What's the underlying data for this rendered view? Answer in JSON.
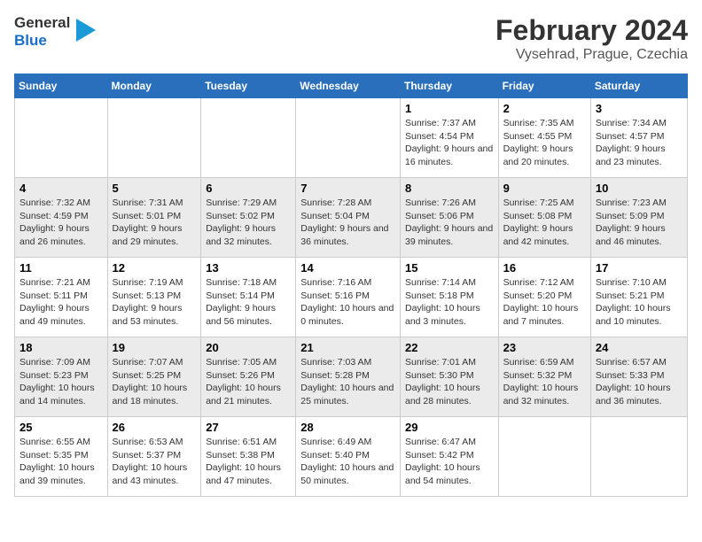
{
  "header": {
    "logo_line1": "General",
    "logo_line2": "Blue",
    "title": "February 2024",
    "subtitle": "Vysehrad, Prague, Czechia"
  },
  "weekdays": [
    "Sunday",
    "Monday",
    "Tuesday",
    "Wednesday",
    "Thursday",
    "Friday",
    "Saturday"
  ],
  "weeks": [
    [
      {
        "day": "",
        "empty": true
      },
      {
        "day": "",
        "empty": true
      },
      {
        "day": "",
        "empty": true
      },
      {
        "day": "",
        "empty": true
      },
      {
        "day": "1",
        "sunrise": "7:37 AM",
        "sunset": "4:54 PM",
        "daylight": "9 hours and 16 minutes."
      },
      {
        "day": "2",
        "sunrise": "7:35 AM",
        "sunset": "4:55 PM",
        "daylight": "9 hours and 20 minutes."
      },
      {
        "day": "3",
        "sunrise": "7:34 AM",
        "sunset": "4:57 PM",
        "daylight": "9 hours and 23 minutes."
      }
    ],
    [
      {
        "day": "4",
        "sunrise": "7:32 AM",
        "sunset": "4:59 PM",
        "daylight": "9 hours and 26 minutes."
      },
      {
        "day": "5",
        "sunrise": "7:31 AM",
        "sunset": "5:01 PM",
        "daylight": "9 hours and 29 minutes."
      },
      {
        "day": "6",
        "sunrise": "7:29 AM",
        "sunset": "5:02 PM",
        "daylight": "9 hours and 32 minutes."
      },
      {
        "day": "7",
        "sunrise": "7:28 AM",
        "sunset": "5:04 PM",
        "daylight": "9 hours and 36 minutes."
      },
      {
        "day": "8",
        "sunrise": "7:26 AM",
        "sunset": "5:06 PM",
        "daylight": "9 hours and 39 minutes."
      },
      {
        "day": "9",
        "sunrise": "7:25 AM",
        "sunset": "5:08 PM",
        "daylight": "9 hours and 42 minutes."
      },
      {
        "day": "10",
        "sunrise": "7:23 AM",
        "sunset": "5:09 PM",
        "daylight": "9 hours and 46 minutes."
      }
    ],
    [
      {
        "day": "11",
        "sunrise": "7:21 AM",
        "sunset": "5:11 PM",
        "daylight": "9 hours and 49 minutes."
      },
      {
        "day": "12",
        "sunrise": "7:19 AM",
        "sunset": "5:13 PM",
        "daylight": "9 hours and 53 minutes."
      },
      {
        "day": "13",
        "sunrise": "7:18 AM",
        "sunset": "5:14 PM",
        "daylight": "9 hours and 56 minutes."
      },
      {
        "day": "14",
        "sunrise": "7:16 AM",
        "sunset": "5:16 PM",
        "daylight": "10 hours and 0 minutes."
      },
      {
        "day": "15",
        "sunrise": "7:14 AM",
        "sunset": "5:18 PM",
        "daylight": "10 hours and 3 minutes."
      },
      {
        "day": "16",
        "sunrise": "7:12 AM",
        "sunset": "5:20 PM",
        "daylight": "10 hours and 7 minutes."
      },
      {
        "day": "17",
        "sunrise": "7:10 AM",
        "sunset": "5:21 PM",
        "daylight": "10 hours and 10 minutes."
      }
    ],
    [
      {
        "day": "18",
        "sunrise": "7:09 AM",
        "sunset": "5:23 PM",
        "daylight": "10 hours and 14 minutes."
      },
      {
        "day": "19",
        "sunrise": "7:07 AM",
        "sunset": "5:25 PM",
        "daylight": "10 hours and 18 minutes."
      },
      {
        "day": "20",
        "sunrise": "7:05 AM",
        "sunset": "5:26 PM",
        "daylight": "10 hours and 21 minutes."
      },
      {
        "day": "21",
        "sunrise": "7:03 AM",
        "sunset": "5:28 PM",
        "daylight": "10 hours and 25 minutes."
      },
      {
        "day": "22",
        "sunrise": "7:01 AM",
        "sunset": "5:30 PM",
        "daylight": "10 hours and 28 minutes."
      },
      {
        "day": "23",
        "sunrise": "6:59 AM",
        "sunset": "5:32 PM",
        "daylight": "10 hours and 32 minutes."
      },
      {
        "day": "24",
        "sunrise": "6:57 AM",
        "sunset": "5:33 PM",
        "daylight": "10 hours and 36 minutes."
      }
    ],
    [
      {
        "day": "25",
        "sunrise": "6:55 AM",
        "sunset": "5:35 PM",
        "daylight": "10 hours and 39 minutes."
      },
      {
        "day": "26",
        "sunrise": "6:53 AM",
        "sunset": "5:37 PM",
        "daylight": "10 hours and 43 minutes."
      },
      {
        "day": "27",
        "sunrise": "6:51 AM",
        "sunset": "5:38 PM",
        "daylight": "10 hours and 47 minutes."
      },
      {
        "day": "28",
        "sunrise": "6:49 AM",
        "sunset": "5:40 PM",
        "daylight": "10 hours and 50 minutes."
      },
      {
        "day": "29",
        "sunrise": "6:47 AM",
        "sunset": "5:42 PM",
        "daylight": "10 hours and 54 minutes."
      },
      {
        "day": "",
        "empty": true
      },
      {
        "day": "",
        "empty": true
      }
    ]
  ]
}
